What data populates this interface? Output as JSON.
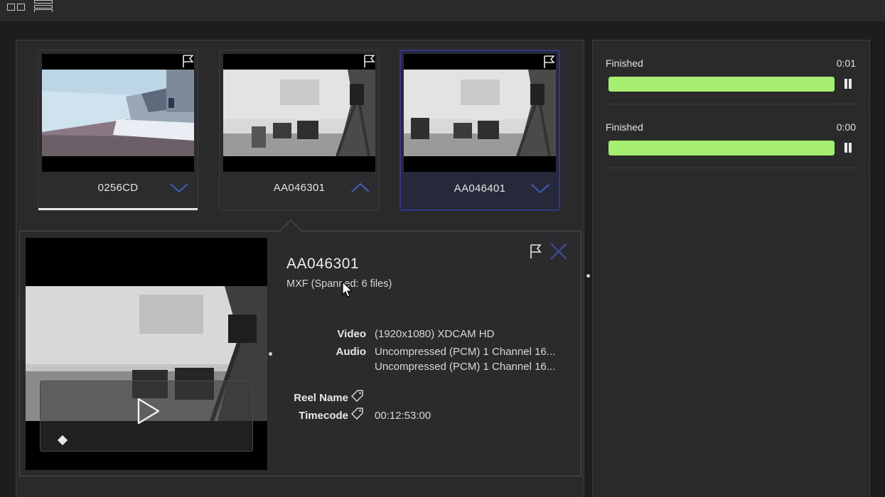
{
  "toolbar": {
    "grid_view_icon": "grid-view-icon",
    "list_view_icon": "list-view-icon"
  },
  "clips": [
    {
      "name": "0256CD",
      "chevron": "down",
      "selected": false,
      "active": true
    },
    {
      "name": "AA046301",
      "chevron": "up",
      "selected": false,
      "active": false
    },
    {
      "name": "AA046401",
      "chevron": "down",
      "selected": true,
      "active": false
    }
  ],
  "detail": {
    "title": "AA046301",
    "format": "MXF (Spanned: 6 files)",
    "video_label": "Video",
    "video_value": "(1920x1080) XDCAM HD",
    "audio_label": "Audio",
    "audio_value_1": "Uncompressed (PCM) 1 Channel 16...",
    "audio_value_2": "Uncompressed (PCM) 1 Channel 16...",
    "reel_label": "Reel Name",
    "reel_value": "",
    "timecode_label": "Timecode",
    "timecode_value": "00:12:53:00"
  },
  "jobs": [
    {
      "status": "Finished",
      "time": "0:01",
      "progress": 1.0
    },
    {
      "status": "Finished",
      "time": "0:00",
      "progress": 1.0
    }
  ],
  "colors": {
    "accent_selected": "#2d3a86",
    "progress_fill": "#a6ee72",
    "close_icon": "#3b4d9c"
  }
}
